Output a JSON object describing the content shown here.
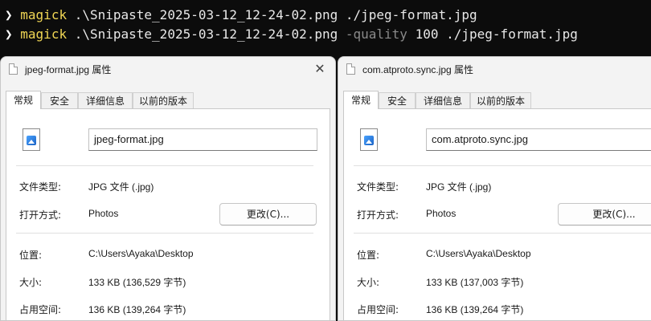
{
  "terminal": {
    "lines": [
      {
        "prompt": "❯",
        "command": "magick",
        "args": ".\\Snipaste_2025-03-12_12-24-02.png ./jpeg-format.jpg",
        "flag": "",
        "flag_value": "",
        "output": ""
      },
      {
        "prompt": "❯",
        "command": "magick",
        "args": ".\\Snipaste_2025-03-12_12-24-02.png",
        "flag": "-quality",
        "flag_value": "100",
        "output": "./jpeg-format.jpg"
      }
    ],
    "colors": {
      "background": "#0c0c0c",
      "command": "#f0d654",
      "flag": "#8a8a8a"
    }
  },
  "dialogs": [
    {
      "title": "jpeg-format.jpg 属性",
      "close_symbol": "✕",
      "tabs": [
        "常规",
        "安全",
        "详细信息",
        "以前的版本"
      ],
      "active_tab": 0,
      "file_name": "jpeg-format.jpg",
      "file_type_label": "文件类型:",
      "file_type_value": "JPG 文件 (.jpg)",
      "open_with_label": "打开方式:",
      "open_with_value": "Photos",
      "change_button": "更改(C)...",
      "location_label": "位置:",
      "location_value": "C:\\Users\\Ayaka\\Desktop",
      "size_label": "大小:",
      "size_value": "133 KB (136,529 字节)",
      "disk_size_label": "占用空间:",
      "disk_size_value": "136 KB (139,264 字节)",
      "icon": "jpg-file-icon"
    },
    {
      "title": "com.atproto.sync.jpg 属性",
      "close_symbol": "",
      "tabs": [
        "常规",
        "安全",
        "详细信息",
        "以前的版本"
      ],
      "active_tab": 0,
      "file_name": "com.atproto.sync.jpg",
      "file_type_label": "文件类型:",
      "file_type_value": "JPG 文件 (.jpg)",
      "open_with_label": "打开方式:",
      "open_with_value": "Photos",
      "change_button": "更改(C)...",
      "location_label": "位置:",
      "location_value": "C:\\Users\\Ayaka\\Desktop",
      "size_label": "大小:",
      "size_value": "133 KB (137,003 字节)",
      "disk_size_label": "占用空间:",
      "disk_size_value": "136 KB (139,264 字节)",
      "icon": "jpg-file-icon"
    }
  ]
}
